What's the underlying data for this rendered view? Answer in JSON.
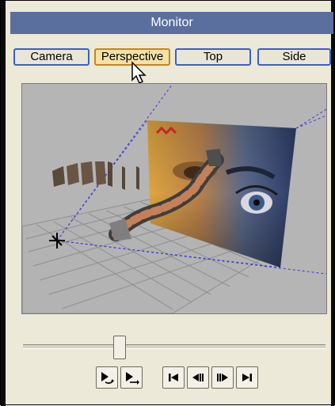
{
  "window": {
    "title": "Monitor"
  },
  "views": [
    {
      "label": "Camera",
      "active": false
    },
    {
      "label": "Perspective",
      "active": true
    },
    {
      "label": "Top",
      "active": false
    },
    {
      "label": "Side",
      "active": false
    }
  ],
  "viewport": {
    "scene": "3d-perspective-grid-with-portrait-plane-and-textured-path",
    "icons": [
      "camera-origin-icon"
    ]
  },
  "timeline": {
    "position_fraction": 0.32
  },
  "playback": {
    "buttons": [
      {
        "name": "play-loop-button",
        "icon": "play-loop-icon"
      },
      {
        "name": "play-once-button",
        "icon": "play-once-icon"
      },
      {
        "name": "go-to-start-button",
        "icon": "go-to-start-icon"
      },
      {
        "name": "step-back-button",
        "icon": "step-back-icon"
      },
      {
        "name": "step-forward-button",
        "icon": "step-forward-icon"
      },
      {
        "name": "go-to-end-button",
        "icon": "go-to-end-icon"
      }
    ]
  },
  "colors": {
    "title_bar": "#5a6f9e",
    "active_button": "#f3e1a6",
    "button_border": "#3b5fc7"
  }
}
